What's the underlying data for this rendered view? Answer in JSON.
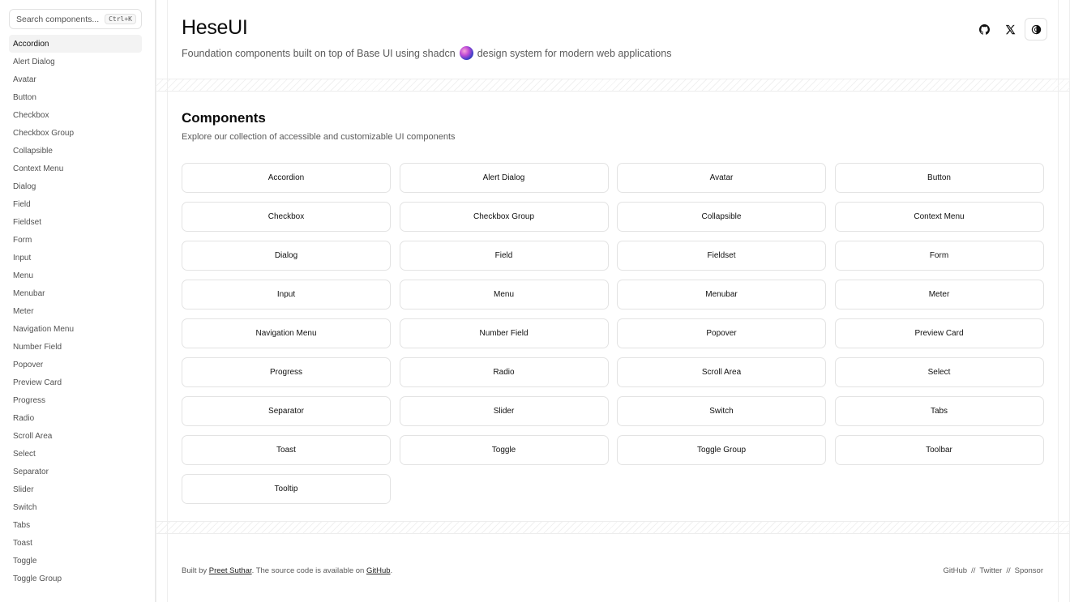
{
  "sidebar": {
    "search_placeholder": "Search components...",
    "shortcut": "Ctrl+K",
    "items": [
      "Accordion",
      "Alert Dialog",
      "Avatar",
      "Button",
      "Checkbox",
      "Checkbox Group",
      "Collapsible",
      "Context Menu",
      "Dialog",
      "Field",
      "Fieldset",
      "Form",
      "Input",
      "Menu",
      "Menubar",
      "Meter",
      "Navigation Menu",
      "Number Field",
      "Popover",
      "Preview Card",
      "Progress",
      "Radio",
      "Scroll Area",
      "Select",
      "Separator",
      "Slider",
      "Switch",
      "Tabs",
      "Toast",
      "Toggle",
      "Toggle Group"
    ],
    "active": "Accordion"
  },
  "header": {
    "title": "HeseUI",
    "subtitle_before": "Foundation components built on top of Base UI using shadcn",
    "subtitle_after": "design system for modern web applications"
  },
  "header_icons": [
    "github-icon",
    "x-icon",
    "theme-toggle-icon"
  ],
  "section": {
    "title": "Components",
    "subtitle": "Explore our collection of accessible and customizable UI components"
  },
  "components": [
    "Accordion",
    "Alert Dialog",
    "Avatar",
    "Button",
    "Checkbox",
    "Checkbox Group",
    "Collapsible",
    "Context Menu",
    "Dialog",
    "Field",
    "Fieldset",
    "Form",
    "Input",
    "Menu",
    "Menubar",
    "Meter",
    "Navigation Menu",
    "Number Field",
    "Popover",
    "Preview Card",
    "Progress",
    "Radio",
    "Scroll Area",
    "Select",
    "Separator",
    "Slider",
    "Switch",
    "Tabs",
    "Toast",
    "Toggle",
    "Toggle Group",
    "Toolbar",
    "Tooltip"
  ],
  "footer": {
    "built_by": "Built by",
    "author": "Preet Suthar",
    "source_text": ". The source code is available on",
    "source_link": "GitHub",
    "end": ".",
    "links": [
      "GitHub",
      "Twitter",
      "Sponsor"
    ],
    "separator": "//"
  }
}
